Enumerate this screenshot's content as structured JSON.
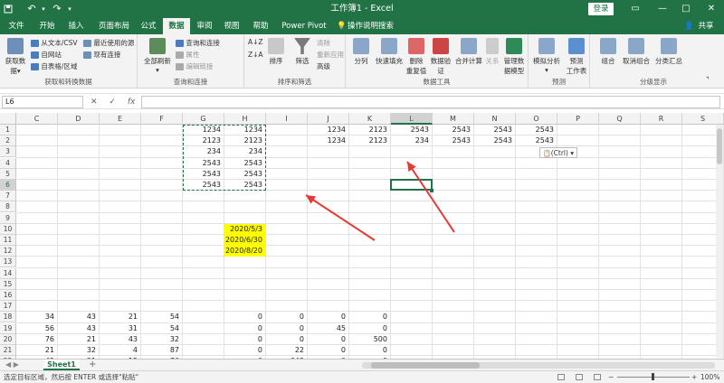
{
  "titlebar": {
    "title": "工作簿1 - Excel",
    "login_label": "登录",
    "save_icon": "save-icon",
    "undo_icon": "undo-icon",
    "redo_icon": "redo-icon"
  },
  "tabs": [
    "文件",
    "开始",
    "插入",
    "页面布局",
    "公式",
    "数据",
    "审阅",
    "视图",
    "帮助",
    "Power Pivot",
    "操作说明搜索"
  ],
  "active_tab": "数据",
  "share_label": "共享",
  "ribbon": {
    "get_data": "获取数据",
    "from_text": "从文本/CSV",
    "from_web": "自网站",
    "from_table": "自表格/区域",
    "recent_sources": "最近使用的源",
    "existing_conn": "现有连接",
    "group1": "获取和转换数据",
    "refresh_all": "全部刷新",
    "queries_conn": "查询和连接",
    "properties": "属性",
    "edit_links": "编辑链接",
    "group2": "查询和连接",
    "sort": "排序",
    "filter": "筛选",
    "clear": "清除",
    "reapply": "重新应用",
    "advanced": "高级",
    "group3": "排序和筛选",
    "text_to_cols": "分列",
    "flash_fill": "快速填充",
    "remove_dup": "删除\n重复值",
    "data_valid": "数据验\n证",
    "consolidate": "合并计算",
    "relationships": "关系",
    "data_model": "管理数\n据模型",
    "group4": "数据工具",
    "whatif": "模拟分析",
    "forecast": "预测\n工作表",
    "group5": "预测",
    "group_btn": "组合",
    "ungroup": "取消组合",
    "subtotal": "分类汇总",
    "group6": "分级显示"
  },
  "formula_bar": {
    "name_box": "L6",
    "fx_cancel": "✕",
    "fx_enter": "✓",
    "fx": "fx",
    "value": ""
  },
  "columns": [
    "C",
    "D",
    "E",
    "F",
    "G",
    "H",
    "I",
    "J",
    "K",
    "L",
    "M",
    "N",
    "O",
    "P",
    "Q",
    "R",
    "S"
  ],
  "rows": [
    "1",
    "2",
    "3",
    "4",
    "5",
    "6",
    "7",
    "8",
    "9",
    "10",
    "11",
    "12",
    "13",
    "14",
    "15",
    "16",
    "17",
    "18",
    "19",
    "20",
    "21",
    "22"
  ],
  "selected_col": "L",
  "selected_row": "6",
  "cells": {
    "G1": "1234",
    "H1": "1234",
    "J1": "1234",
    "K1": "2123",
    "L1": "2543",
    "M1": "2543",
    "N1": "2543",
    "O1": "2543",
    "G2": "2123",
    "H2": "2123",
    "J2": "1234",
    "K2": "2123",
    "L2": "234",
    "M2": "2543",
    "N2": "2543",
    "O2": "2543",
    "G3": "234",
    "H3": "234",
    "G4": "2543",
    "H4": "2543",
    "G5": "2543",
    "H5": "2543",
    "G6": "2543",
    "H6": "2543",
    "H10": "2020/5/3",
    "H11": "2020/6/30",
    "H12": "2020/8/20",
    "C18": "34",
    "D18": "43",
    "E18": "21",
    "F18": "54",
    "H18": "0",
    "I18": "0",
    "J18": "0",
    "K18": "0",
    "C19": "56",
    "D19": "43",
    "E19": "31",
    "F19": "54",
    "H19": "0",
    "I19": "0",
    "J19": "45",
    "K19": "0",
    "C20": "76",
    "D20": "21",
    "E20": "43",
    "F20": "32",
    "H20": "0",
    "I20": "0",
    "J20": "0",
    "K20": "500",
    "C21": "21",
    "D21": "32",
    "E21": "4",
    "F21": "87",
    "H21": "0",
    "I21": "22",
    "J21": "0",
    "K21": "0",
    "C22": "42",
    "D22": "21",
    "E22": "15",
    "F22": "76",
    "H22": "0",
    "I22": "643",
    "J22": "0",
    "K22": "0"
  },
  "paste_options": "(Ctrl)",
  "sheet_tab": "Sheet1",
  "add_sheet": "+",
  "status_text": "选定目标区域，然后按 ENTER 或选择\"粘贴\"",
  "zoom": "100%",
  "colors": {
    "excel_green": "#217346",
    "arrow_red": "#e53935",
    "highlight": "#ffff00"
  }
}
